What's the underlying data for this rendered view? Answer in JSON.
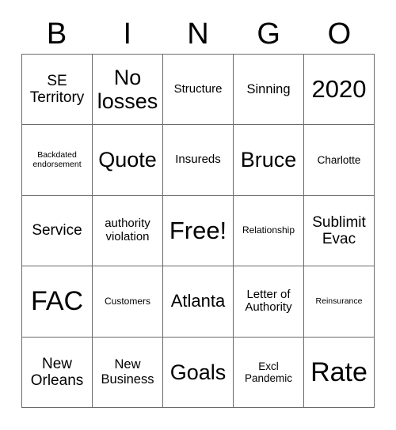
{
  "card": {
    "title": "BINGO",
    "header_letters": [
      "B",
      "I",
      "N",
      "G",
      "O"
    ],
    "grid_size": "5x5",
    "border_color": "#6b6b6b",
    "text_color": "#000000",
    "background_color": "#ffffff",
    "rows": [
      [
        {
          "text": "SE Territory",
          "size": "sz-l"
        },
        {
          "text": "No losses",
          "size": "sz-xxl"
        },
        {
          "text": "Structure",
          "size": "sz-m"
        },
        {
          "text": "Sinning",
          "size": "sz-ml"
        },
        {
          "text": "2020",
          "size": "sz-3xl"
        }
      ],
      [
        {
          "text": "Backdated endorsement",
          "size": "sz-xs"
        },
        {
          "text": "Quote",
          "size": "sz-xxl"
        },
        {
          "text": "Insureds",
          "size": "sz-m"
        },
        {
          "text": "Bruce",
          "size": "sz-xxl"
        },
        {
          "text": "Charlotte",
          "size": "sz-sm"
        }
      ],
      [
        {
          "text": "Service",
          "size": "sz-l"
        },
        {
          "text": "authority violation",
          "size": "sz-m"
        },
        {
          "text": "Free!",
          "size": "sz-3xl"
        },
        {
          "text": "Relationship",
          "size": "sz-s"
        },
        {
          "text": "Sublimit Evac",
          "size": "sz-l"
        }
      ],
      [
        {
          "text": "FAC",
          "size": "sz-4xl"
        },
        {
          "text": "Customers",
          "size": "sz-s"
        },
        {
          "text": "Atlanta",
          "size": "sz-xl"
        },
        {
          "text": "Letter of Authority",
          "size": "sz-m"
        },
        {
          "text": "Reinsurance",
          "size": "sz-xs"
        }
      ],
      [
        {
          "text": "New Orleans",
          "size": "sz-l"
        },
        {
          "text": "New Business",
          "size": "sz-ml"
        },
        {
          "text": "Goals",
          "size": "sz-xxl"
        },
        {
          "text": "Excl Pandemic",
          "size": "sz-sm"
        },
        {
          "text": "Rate",
          "size": "sz-4xl"
        }
      ]
    ]
  }
}
